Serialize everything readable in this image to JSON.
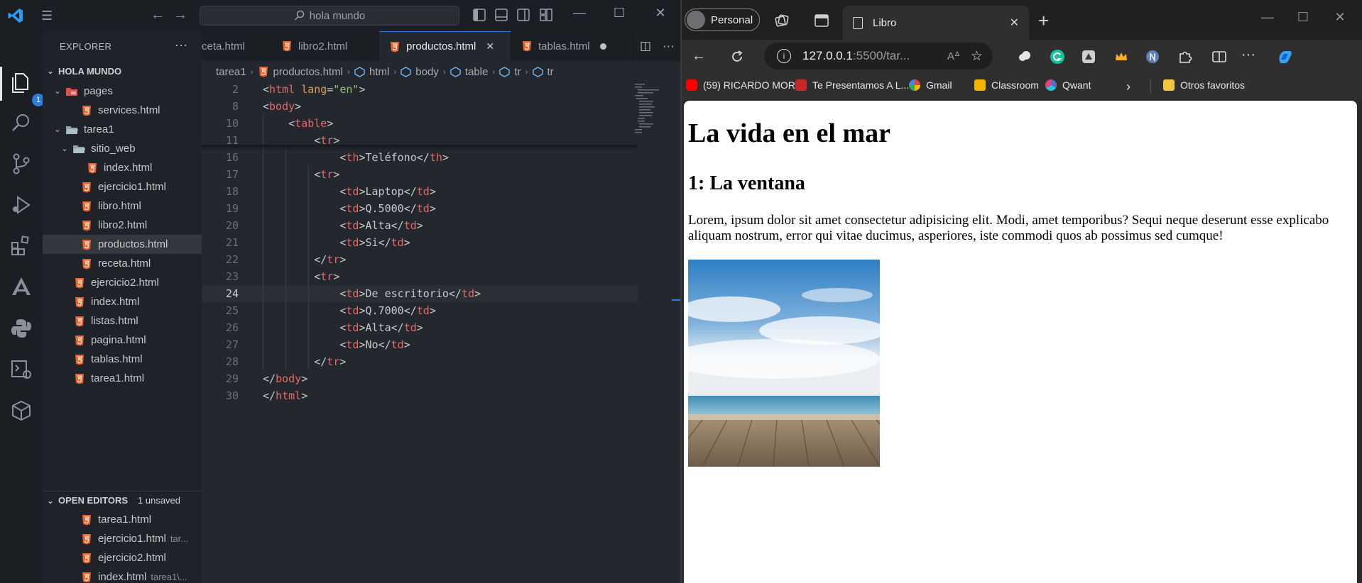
{
  "vscode": {
    "search": "hola mundo",
    "explorer_title": "EXPLORER",
    "activity_badge": "1",
    "workspace_title": "HOLA MUNDO",
    "tree": [
      {
        "label": "pages",
        "type": "folder"
      },
      {
        "label": "services.html",
        "type": "file"
      },
      {
        "label": "tarea1",
        "type": "folder"
      },
      {
        "label": "sitio_web",
        "type": "folder"
      },
      {
        "label": "index.html",
        "type": "file"
      },
      {
        "label": "ejercicio1.html",
        "type": "file"
      },
      {
        "label": "libro.html",
        "type": "file"
      },
      {
        "label": "libro2.html",
        "type": "file"
      },
      {
        "label": "productos.html",
        "type": "file",
        "selected": true
      },
      {
        "label": "receta.html",
        "type": "file"
      },
      {
        "label": "ejercicio2.html",
        "type": "file"
      },
      {
        "label": "index.html",
        "type": "file"
      },
      {
        "label": "listas.html",
        "type": "file"
      },
      {
        "label": "pagina.html",
        "type": "file"
      },
      {
        "label": "tablas.html",
        "type": "file"
      },
      {
        "label": "tarea1.html",
        "type": "file"
      }
    ],
    "open_editors": {
      "title": "OPEN EDITORS",
      "unsaved": "1 unsaved",
      "items": [
        {
          "label": "tarea1.html",
          "sub": ""
        },
        {
          "label": "ejercicio1.html",
          "sub": "tar..."
        },
        {
          "label": "ejercicio2.html",
          "sub": ""
        },
        {
          "label": "index.html",
          "sub": "tarea1\\..."
        }
      ]
    },
    "tabs": [
      {
        "label": "ceta.html"
      },
      {
        "label": "libro2.html"
      },
      {
        "label": "productos.html"
      },
      {
        "label": "tablas.html"
      }
    ],
    "breadcrumb": [
      "tarea1",
      "productos.html",
      "html",
      "body",
      "table",
      "tr",
      "tr"
    ],
    "code": [
      {
        "n": "2",
        "text": "<html lang=\"en\">"
      },
      {
        "n": "8",
        "text": "<body>"
      },
      {
        "n": "10",
        "text": "    <table>"
      },
      {
        "n": "11",
        "text": "        <tr>"
      },
      {
        "n": "16",
        "text": "            <th>Teléfono</th>"
      },
      {
        "n": "17",
        "text": "        <tr>"
      },
      {
        "n": "18",
        "text": "            <td>Laptop</td>"
      },
      {
        "n": "19",
        "text": "            <td>Q.5000</td>"
      },
      {
        "n": "20",
        "text": "            <td>Alta</td>"
      },
      {
        "n": "21",
        "text": "            <td>Si</td>"
      },
      {
        "n": "22",
        "text": "        </tr>"
      },
      {
        "n": "23",
        "text": "        <tr>"
      },
      {
        "n": "24",
        "text": "            <td>De escritorio</td>"
      },
      {
        "n": "25",
        "text": "            <td>Q.7000</td>"
      },
      {
        "n": "26",
        "text": "            <td>Alta</td>"
      },
      {
        "n": "27",
        "text": "            <td>No</td>"
      },
      {
        "n": "28",
        "text": "        </tr>"
      },
      {
        "n": "29",
        "text": "</body>"
      },
      {
        "n": "30",
        "text": "</html>"
      }
    ],
    "current_line": "24",
    "colors": {
      "accent": "#2f7bd8",
      "tag": "#e36a6a",
      "attr": "#d7a15a",
      "string": "#8ec07c",
      "html_icon": "#e8632b"
    }
  },
  "browser": {
    "profile": "Personal",
    "tab_title": "Libro",
    "address_host": "127.0.0.1",
    "address_path": ":5500/tar...",
    "bookmarks": [
      {
        "label": "(59) RICARDO MOR...",
        "icon": "youtube-icon"
      },
      {
        "label": "Te Presentamos A L...",
        "icon": "site-icon"
      },
      {
        "label": "Gmail",
        "icon": "google-icon"
      },
      {
        "label": "Classroom",
        "icon": "classroom-icon"
      },
      {
        "label": "Qwant",
        "icon": "qwant-icon"
      }
    ],
    "other_favorites": "Otros favoritos",
    "page": {
      "h1": "La vida en el mar",
      "h2": "1: La ventana",
      "paragraph": "Lorem, ipsum dolor sit amet consectetur adipisicing elit. Modi, amet temporibus? Sequi neque deserunt esse explicabo aliquam nostrum, error qui vitae ducimus, asperiores, iste commodi quos ab possimus sed cumque!"
    }
  }
}
